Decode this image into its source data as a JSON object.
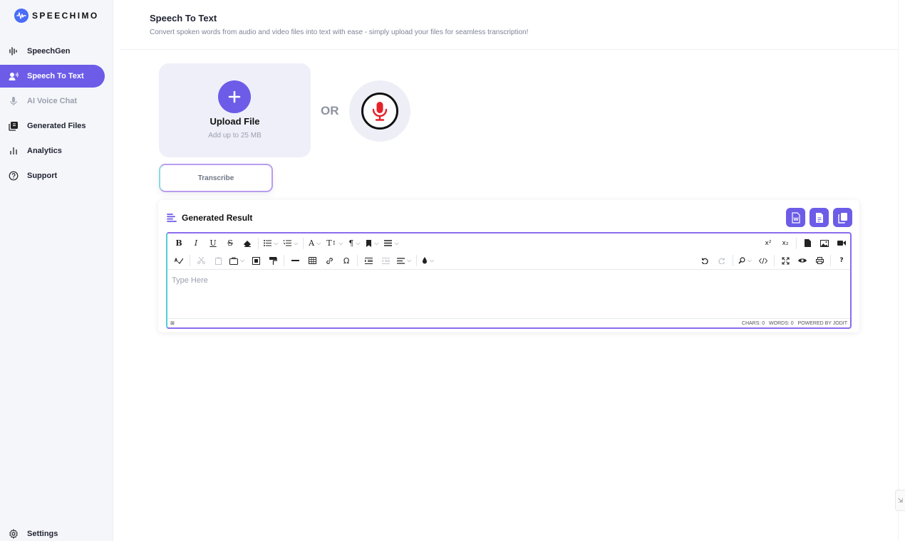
{
  "brand": {
    "name": "SPEECHIMO",
    "accent": "#6c5ce7",
    "logo_color": "#4a6cf7"
  },
  "sidebar": {
    "items": [
      {
        "label": "SpeechGen",
        "icon": "waveform-icon"
      },
      {
        "label": "Speech To Text",
        "icon": "voice-person-icon",
        "active": true
      },
      {
        "label": "AI Voice Chat",
        "icon": "microphone-icon",
        "disabled": true
      },
      {
        "label": "Generated Files",
        "icon": "files-icon"
      },
      {
        "label": "Analytics",
        "icon": "bar-chart-icon"
      },
      {
        "label": "Support",
        "icon": "help-circle-icon"
      }
    ],
    "settings_label": "Settings"
  },
  "header": {
    "title": "Speech To Text",
    "subtitle": "Convert spoken words from audio and video files into text with ease - simply upload your files for seamless transcription!"
  },
  "upload": {
    "title": "Upload File",
    "subtitle": "Add up to 25 MB"
  },
  "or_label": "OR",
  "transcribe_label": "Transcribe",
  "result": {
    "title": "Generated Result",
    "actions": [
      "word-export-icon",
      "document-export-icon",
      "copy-icon"
    ]
  },
  "editor": {
    "toolbar_row1": [
      "B",
      "I",
      "U",
      "S",
      "A",
      "T",
      "¶"
    ],
    "sup_label": "x²",
    "sub_label": "x₂",
    "placeholder": "Type Here",
    "chars_label": "CHARS: 0",
    "words_label": "WORDS: 0",
    "powered_label": "POWERED BY JODIT"
  }
}
